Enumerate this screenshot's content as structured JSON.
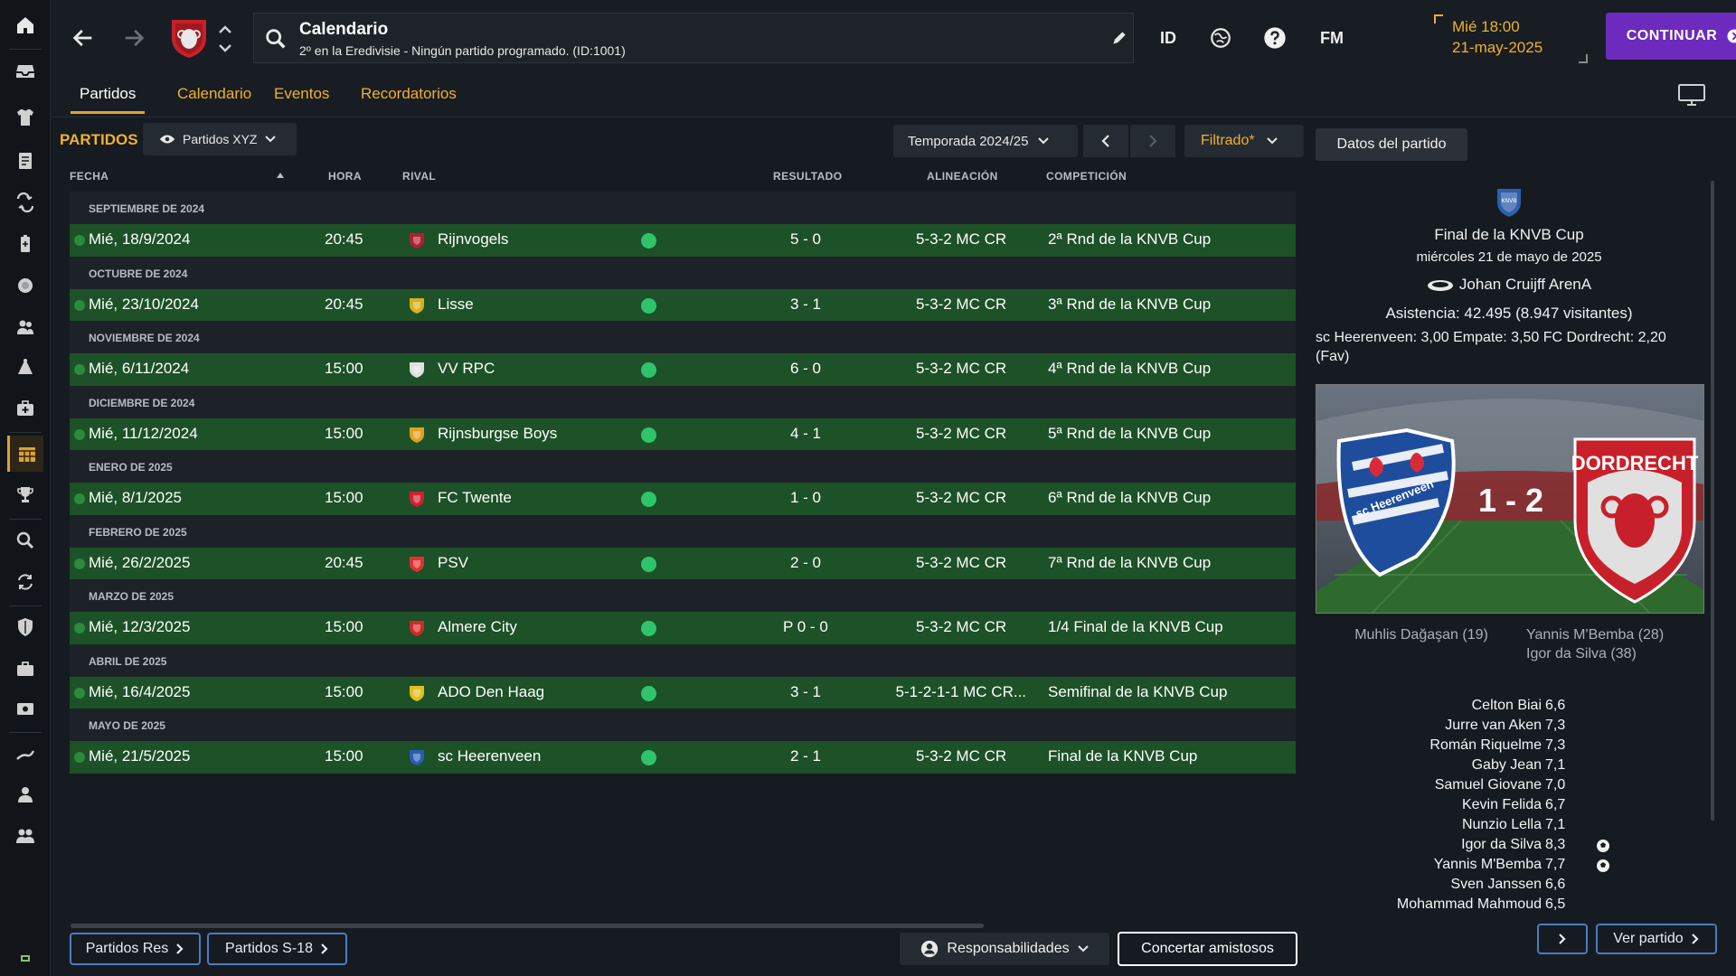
{
  "header": {
    "title": "Calendario",
    "subtitle": "2º en la Eredivisie - Ningún partido programado. (ID:1001)",
    "id_label": "ID",
    "fm_label": "FM",
    "time": "Mié 18:00",
    "date": "21-may-2025",
    "continue_label": "CONTINUAR"
  },
  "tabs": [
    {
      "label": "Partidos",
      "active": true
    },
    {
      "label": "Calendario",
      "active": false
    },
    {
      "label": "Eventos",
      "active": false
    },
    {
      "label": "Recordatorios",
      "active": false
    }
  ],
  "toolbar": {
    "section_label": "PARTIDOS",
    "view_label": "Partidos XYZ",
    "season_label": "Temporada 2024/25",
    "filter_label": "Filtrado*",
    "detail_label": "Datos del partido"
  },
  "table": {
    "columns": {
      "fecha": "FECHA",
      "hora": "HORA",
      "rival": "RIVAL",
      "resultado": "RESULTADO",
      "alineacion": "ALINEACIÓN",
      "competicion": "COMPETICIÓN"
    },
    "groups": [
      {
        "month": "SEPTIEMBRE DE 2024",
        "match": {
          "date": "Mié, 18/9/2024",
          "time": "20:45",
          "rival": "Rijnvogels",
          "result": "5 - 0",
          "lineup": "5-3-2 MC CR",
          "competition": "2ª Rnd de la KNVB Cup",
          "crest_color": "#b02030"
        }
      },
      {
        "month": "OCTUBRE DE 2024",
        "match": {
          "date": "Mié, 23/10/2024",
          "time": "20:45",
          "rival": "Lisse",
          "result": "3 - 1",
          "lineup": "5-3-2 MC CR",
          "competition": "3ª Rnd de la KNVB Cup",
          "crest_color": "#d4b020"
        }
      },
      {
        "month": "NOVIEMBRE DE 2024",
        "match": {
          "date": "Mié, 6/11/2024",
          "time": "15:00",
          "rival": "VV RPC",
          "result": "6 - 0",
          "lineup": "5-3-2 MC CR",
          "competition": "4ª Rnd de la KNVB Cup",
          "crest_color": "#e0e0e0"
        }
      },
      {
        "month": "DICIEMBRE DE 2024",
        "match": {
          "date": "Mié, 11/12/2024",
          "time": "15:00",
          "rival": "Rijnsburgse Boys",
          "result": "4 - 1",
          "lineup": "5-3-2 MC CR",
          "competition": "5ª Rnd de la KNVB Cup",
          "crest_color": "#e0a020"
        }
      },
      {
        "month": "ENERO DE 2025",
        "match": {
          "date": "Mié, 8/1/2025",
          "time": "15:00",
          "rival": "FC Twente",
          "result": "1 - 0",
          "lineup": "5-3-2 MC CR",
          "competition": "6ª Rnd de la KNVB Cup",
          "crest_color": "#d02030"
        }
      },
      {
        "month": "FEBRERO DE 2025",
        "match": {
          "date": "Mié, 26/2/2025",
          "time": "20:45",
          "rival": "PSV",
          "result": "2 - 0",
          "lineup": "5-3-2 MC CR",
          "competition": "7ª Rnd de la KNVB Cup",
          "crest_color": "#e03030"
        }
      },
      {
        "month": "MARZO DE 2025",
        "match": {
          "date": "Mié, 12/3/2025",
          "time": "15:00",
          "rival": "Almere City",
          "result": "P 0 - 0",
          "lineup": "5-3-2 MC CR",
          "competition": "1/4 Final de la KNVB Cup",
          "crest_color": "#d02a2a"
        }
      },
      {
        "month": "ABRIL DE 2025",
        "match": {
          "date": "Mié, 16/4/2025",
          "time": "15:00",
          "rival": "ADO Den Haag",
          "result": "3 - 1",
          "lineup": "5-1-2-1-1 MC CR...",
          "competition": "Semifinal de la KNVB Cup",
          "crest_color": "#e0c020"
        }
      },
      {
        "month": "MAYO DE 2025",
        "match": {
          "date": "Mié, 21/5/2025",
          "time": "15:00",
          "rival": "sc Heerenveen",
          "result": "2 - 1",
          "lineup": "5-3-2 MC CR",
          "competition": "Final de la KNVB Cup",
          "crest_color": "#2a5db0"
        }
      }
    ]
  },
  "bottom": {
    "res_label": "Partidos Res",
    "u18_label": "Partidos S-18",
    "resp_label": "Responsabilidades",
    "friendly_label": "Concertar amistosos"
  },
  "panel": {
    "competition": "Final de la KNVB Cup",
    "date": "miércoles 21 de mayo de 2025",
    "stadium": "Johan Cruijff ArenA",
    "attendance": "Asistencia: 42.495 (8.947 visitantes)",
    "odds": "sc Heerenveen: 3,00 Empate: 3,50 FC Dordrecht: 2,20 (Fav)",
    "home_team": "sc Heerenveen",
    "away_team": "DORDRECHT",
    "score": "1 - 2",
    "home_scorers": [
      "Muhlis Dağaşan (19)"
    ],
    "away_scorers": [
      "Yannis M'Bemba (28)",
      "Igor da Silva (38)"
    ],
    "players": [
      {
        "name": "Celton Biai",
        "rating": "6,6",
        "goal": false
      },
      {
        "name": "Jurre van Aken",
        "rating": "7,3",
        "goal": false
      },
      {
        "name": "Román Riquelme",
        "rating": "7,3",
        "goal": false
      },
      {
        "name": "Gaby Jean",
        "rating": "7,1",
        "goal": false
      },
      {
        "name": "Samuel Giovane",
        "rating": "7,0",
        "goal": false
      },
      {
        "name": "Kevin Felida",
        "rating": "6,7",
        "goal": false
      },
      {
        "name": "Nunzio Lella",
        "rating": "7,1",
        "goal": false
      },
      {
        "name": "Igor da Silva",
        "rating": "8,3",
        "goal": true
      },
      {
        "name": "Yannis M'Bemba",
        "rating": "7,7",
        "goal": true
      },
      {
        "name": "Sven Janssen",
        "rating": "6,6",
        "goal": false
      },
      {
        "name": "Mohammad Mahmoud",
        "rating": "6,5",
        "goal": false
      }
    ],
    "view_match_label": "Ver partido"
  },
  "colors": {
    "accent": "#f0b030",
    "continue": "#6c2bbd",
    "match_row": "#1d5127",
    "status_win": "#2fc46a"
  }
}
